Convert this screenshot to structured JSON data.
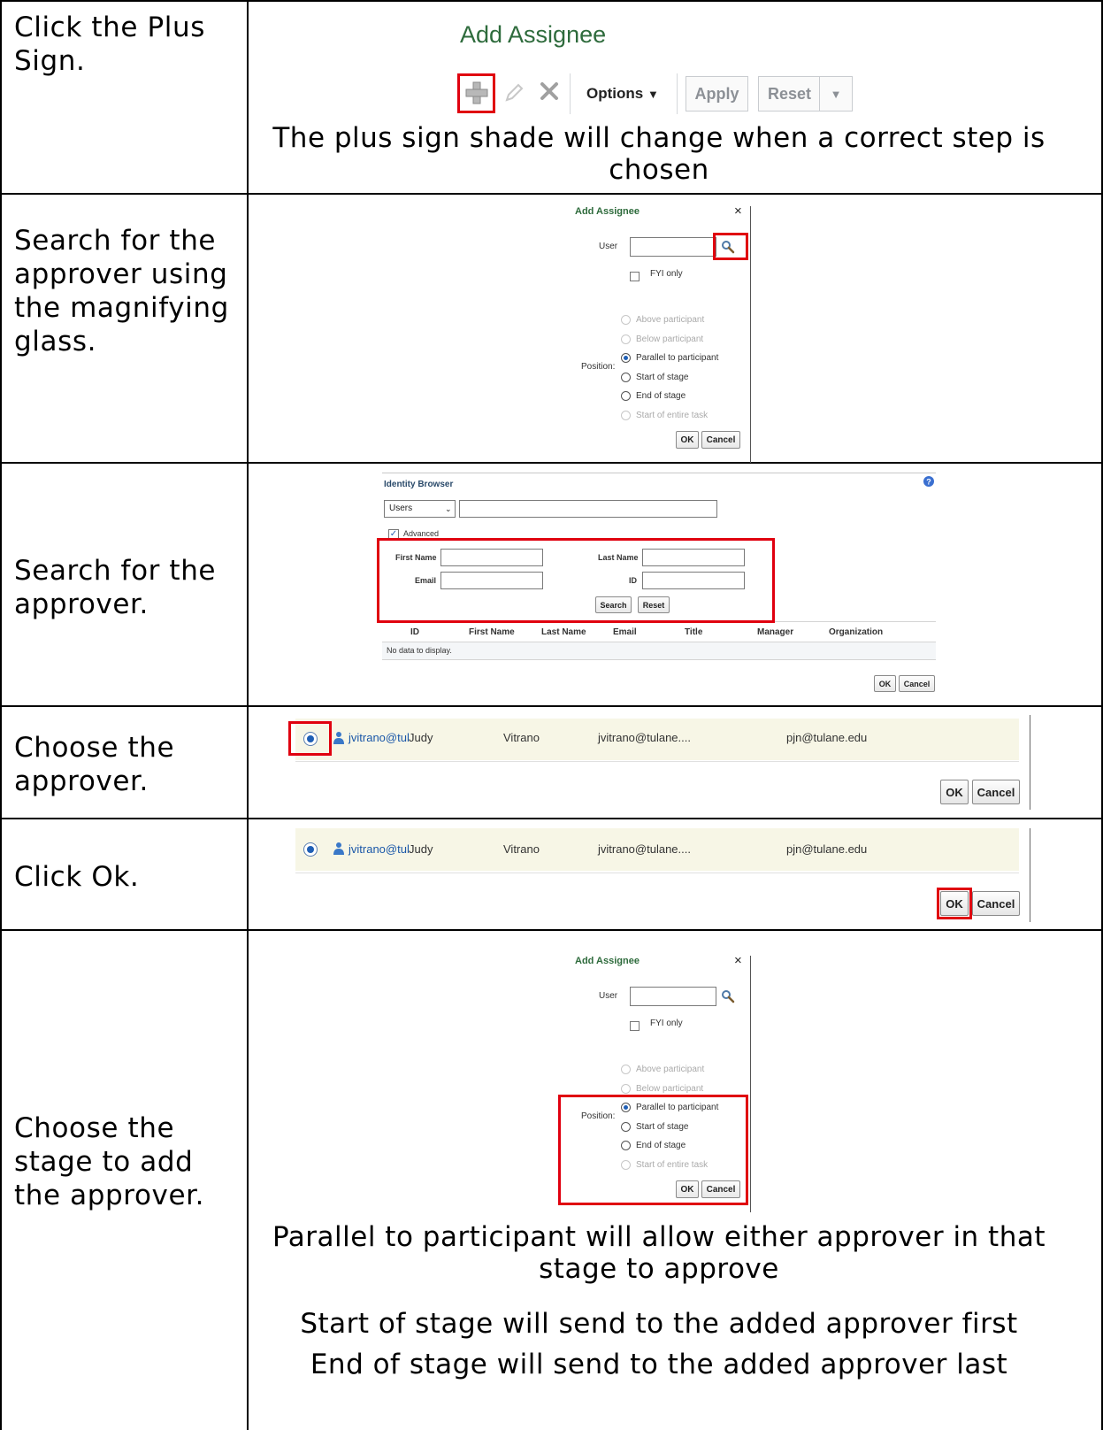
{
  "rows": [
    {
      "step": "Click the Plus Sign.",
      "notes": [
        "The plus sign shade will change when a correct step is chosen"
      ],
      "toolbar": {
        "title": "Add Assignee",
        "options_label": "Options",
        "apply_label": "Apply",
        "reset_label": "Reset"
      }
    },
    {
      "step": "Search for the approver using the magnifying glass.",
      "dialog": {
        "title": "Add Assignee",
        "close": "×",
        "user_label": "User",
        "user_value": "",
        "fyi_label": "FYI only",
        "position_label": "Position:",
        "options": [
          "Above participant",
          "Below participant",
          "Parallel to participant",
          "Start of stage",
          "End of stage",
          "Start of entire task"
        ],
        "selected_option": "Parallel to participant",
        "ok_label": "OK",
        "cancel_label": "Cancel"
      }
    },
    {
      "step": "Search for the approver.",
      "identity_browser": {
        "title": "Identity Browser",
        "type_select": "Users",
        "search_value": "",
        "advanced_label": "Advanced",
        "first_name_label": "First Name",
        "last_name_label": "Last Name",
        "email_label": "Email",
        "id_label": "ID",
        "search_button": "Search",
        "reset_button": "Reset",
        "columns": [
          "ID",
          "First Name",
          "Last Name",
          "Email",
          "Title",
          "Manager",
          "Organization"
        ],
        "empty_message": "No data to display.",
        "ok_label": "OK",
        "cancel_label": "Cancel"
      }
    },
    {
      "step": "Choose the approver.",
      "result": {
        "user_id": "jvitrano@tul",
        "first_name": "Judy",
        "last_name": "Vitrano",
        "email": "jvitrano@tulane....",
        "manager": "pjn@tulane.edu",
        "ok_label": "OK",
        "cancel_label": "Cancel"
      }
    },
    {
      "step": "Click Ok.",
      "result": {
        "user_id": "jvitrano@tul",
        "first_name": "Judy",
        "last_name": "Vitrano",
        "email": "jvitrano@tulane....",
        "manager": "pjn@tulane.edu",
        "ok_label": "OK",
        "cancel_label": "Cancel"
      }
    },
    {
      "step": "Choose the stage to add the approver.",
      "dialog": {
        "title": "Add Assignee",
        "close": "×",
        "user_label": "User",
        "user_value": "",
        "fyi_label": "FYI only",
        "position_label": "Position:",
        "options": [
          "Above participant",
          "Below participant",
          "Parallel to participant",
          "Start of stage",
          "End of stage",
          "Start of entire task"
        ],
        "selected_option": "Parallel to participant",
        "ok_label": "OK",
        "cancel_label": "Cancel"
      },
      "notes": [
        "Parallel to participant will allow either approver in that stage to approve",
        "Start of stage will send to the added approver first",
        "End of stage will send to the added approver last"
      ]
    }
  ],
  "colors": {
    "highlight": "#e0000f",
    "title_green": "#2e6b3c",
    "row_highlight": "#f7f6e6",
    "radio_blue": "#1f5fb5"
  }
}
